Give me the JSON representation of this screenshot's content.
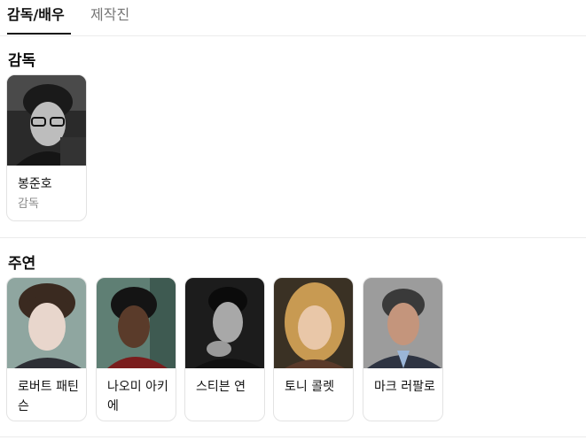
{
  "tabs": {
    "active": "감독/배우",
    "inactive": "제작진"
  },
  "directors": {
    "title": "감독",
    "cards": [
      {
        "name": "봉준호",
        "role": "감독",
        "photo": "director-portrait"
      }
    ]
  },
  "leads": {
    "title": "주연",
    "cards": [
      {
        "name": "로버트 패틴슨",
        "photo": "actor-portrait"
      },
      {
        "name": "나오미 아키에",
        "photo": "actor-portrait"
      },
      {
        "name": "스티븐 연",
        "photo": "actor-portrait"
      },
      {
        "name": "토니 콜렛",
        "photo": "actor-portrait"
      },
      {
        "name": "마크 러팔로",
        "photo": "actor-portrait"
      }
    ]
  }
}
